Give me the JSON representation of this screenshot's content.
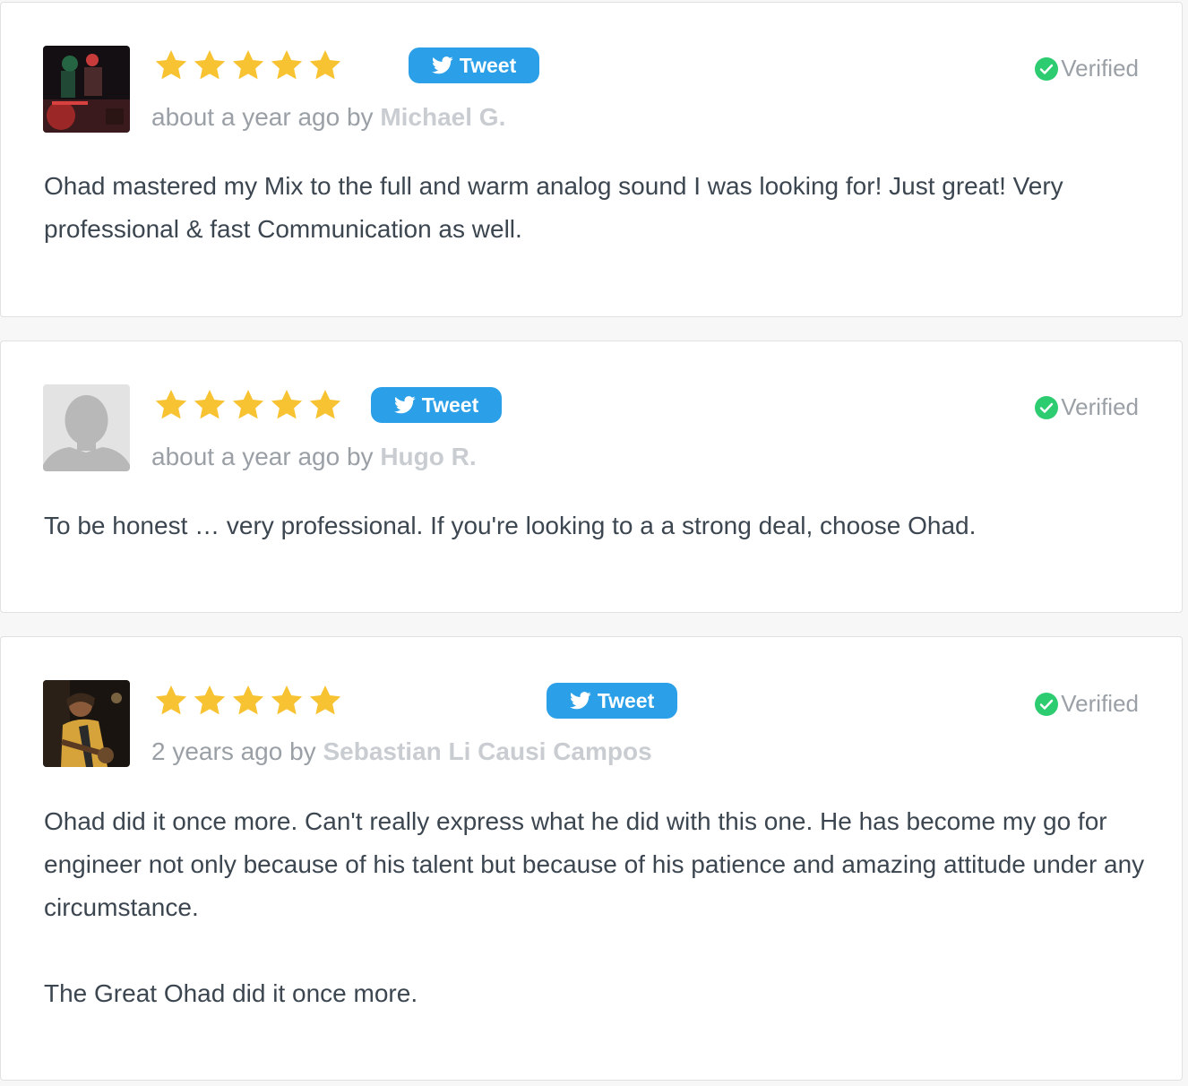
{
  "colors": {
    "star": "#f8c332",
    "tweet_button": "#2b9fe8",
    "verified_check": "#2ecc71",
    "author": "#c9cdd1",
    "meta": "#9aa0a6",
    "text": "#3c4650"
  },
  "reviews": [
    {
      "rating": 5,
      "avatar_icon": "photo-avatar-red-stage",
      "tweet_label": "Tweet",
      "verified_label": "Verified",
      "time": "about a year ago",
      "by": "by",
      "author": "Michael G.",
      "paragraphs": [
        "Ohad mastered my Mix to the full and warm analog sound I was looking for! Just great! Very professional & fast Communication as well."
      ]
    },
    {
      "rating": 5,
      "avatar_icon": "default-user-avatar-icon",
      "tweet_label": "Tweet",
      "verified_label": "Verified",
      "time": "about a year ago",
      "by": "by",
      "author": "Hugo R.",
      "paragraphs": [
        "To be honest … very professional. If you're looking to a a strong deal, choose Ohad."
      ]
    },
    {
      "rating": 5,
      "avatar_icon": "photo-avatar-guitarist",
      "tweet_label": "Tweet",
      "verified_label": "Verified",
      "time": "2 years ago",
      "by": "by",
      "author": "Sebastian Li Causi Campos",
      "paragraphs": [
        "Ohad did it once more. Can't really express what he did with this one. He has become my go for engineer not only because of his talent but because of his patience and amazing attitude under any circumstance.",
        "The Great Ohad did it once more."
      ]
    }
  ]
}
